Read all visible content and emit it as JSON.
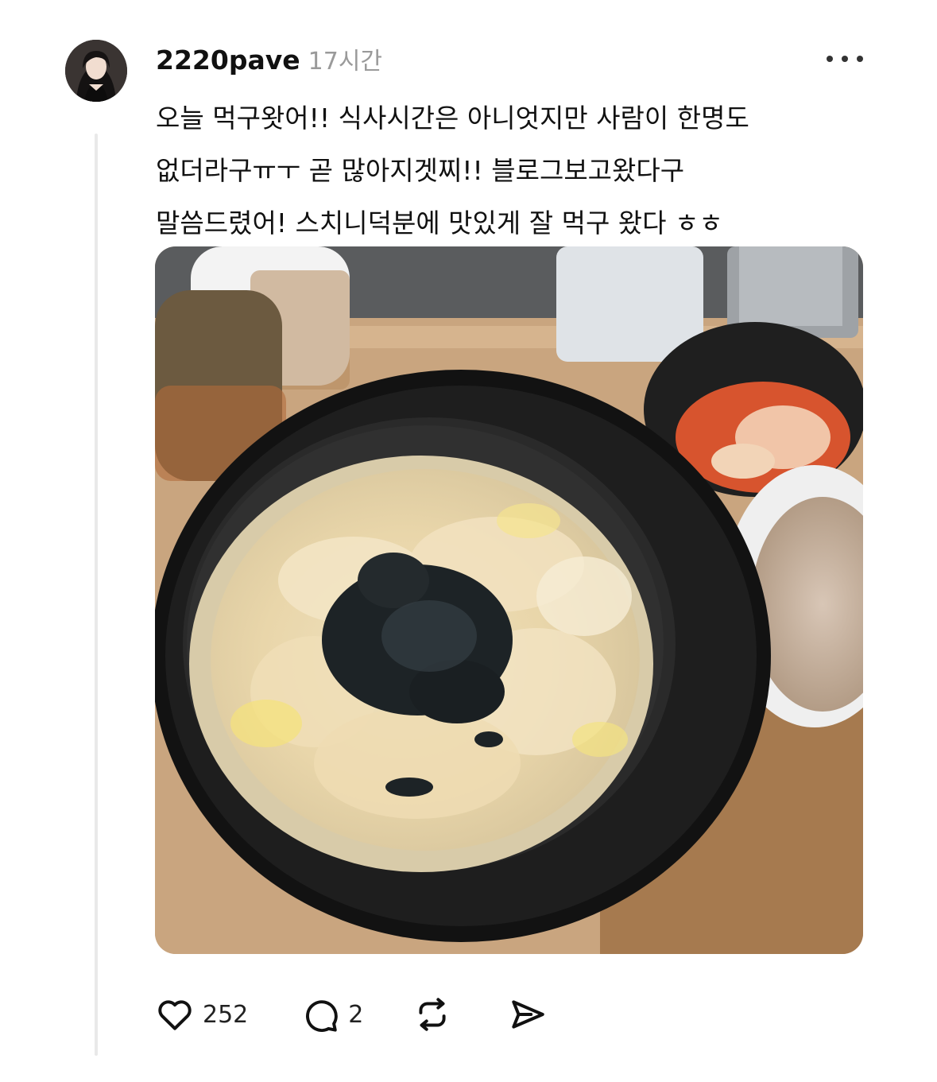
{
  "post": {
    "author": "2220pave",
    "time": "17시간",
    "text_lines": [
      "오늘 먹구왓어!! 식사시간은 아니엇지만 사람이 한명도",
      "없더라구ㅠㅜ 곧 많아지겟찌!! 블로그보고왔다구",
      "말씀드렸어! 스치니덕분에 맛있게 잘 먹구 왔다 ㅎㅎ"
    ]
  },
  "actions": {
    "likes": "252",
    "replies": "2"
  },
  "icons": {
    "more": "more-horizontal-icon",
    "like": "heart-icon",
    "reply": "speech-bubble-icon",
    "repost": "repost-icon",
    "share": "send-icon"
  },
  "colors": {
    "text": "#111111",
    "muted": "#9a9a9a",
    "thread_line": "#e9e9e9"
  }
}
